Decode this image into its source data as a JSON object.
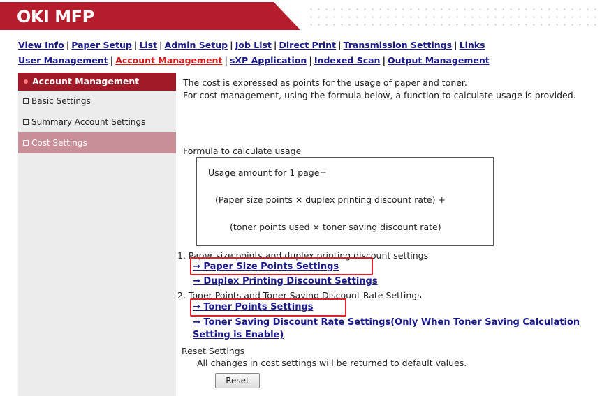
{
  "header": {
    "brand": "OKI MFP"
  },
  "nav": {
    "row1": [
      "View Info",
      "Paper Setup",
      "List",
      "Admin Setup",
      "Job List",
      "Direct Print",
      "Transmission Settings",
      "Links"
    ],
    "row2": [
      "User Management",
      "Account Management",
      "sXP Application",
      "Indexed Scan",
      "Output Management"
    ],
    "active": "Account Management"
  },
  "sidebar": {
    "heading": "Account Management",
    "items": [
      {
        "label": "Basic Settings"
      },
      {
        "label": "Summary Account Settings"
      },
      {
        "label": "Cost Settings"
      }
    ],
    "active": "Cost Settings"
  },
  "content": {
    "intro_1": "The cost is expressed as points for the usage of paper and toner.",
    "intro_2": "For cost management, using the formula below, a function to calculate usage is provided.",
    "formula_title": "Formula to calculate usage",
    "formula_line1": "Usage amount for 1 page=",
    "formula_line2": "(Paper size points × duplex printing discount rate) +",
    "formula_line3": "(toner points used × toner saving discount rate)",
    "section1": "1. Paper size points and duplex printing discount settings",
    "link_paper_size": "→ Paper Size Points Settings",
    "link_duplex": "→ Duplex Printing Discount Settings",
    "section2": "2. Toner Points and Toner Saving Discount Rate Settings",
    "link_toner_points": "→ Toner Points Settings",
    "link_toner_saving": "→ Toner Saving Discount Rate Settings(Only When Toner Saving Calculation Setting is Enable)",
    "reset_title": "Reset Settings",
    "reset_desc": "All changes in cost settings will be returned to default values.",
    "reset_button": "Reset"
  },
  "colors": {
    "brand_red": "#b51c2c",
    "link_blue": "#1a1a8c",
    "highlight_red": "#e0202a"
  }
}
